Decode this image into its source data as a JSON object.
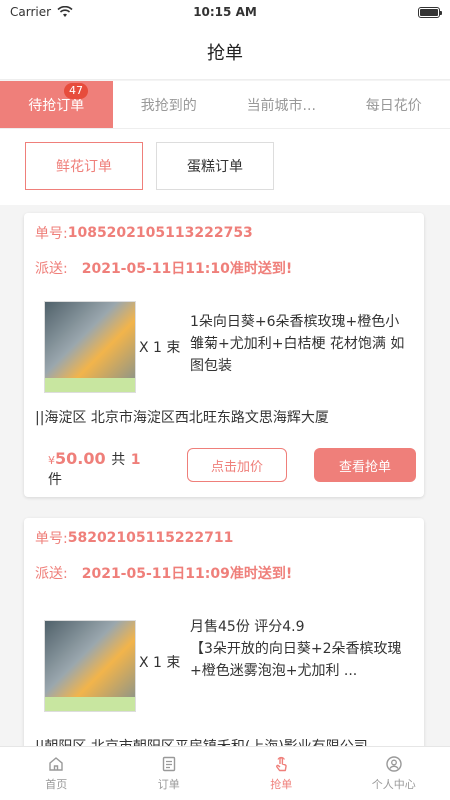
{
  "status": {
    "carrier": "Carrier",
    "time": "10:15 AM"
  },
  "header": {
    "title": "抢单"
  },
  "tabs": [
    {
      "label": "待抢订单",
      "badge": "47",
      "active": true
    },
    {
      "label": "我抢到的",
      "active": false
    },
    {
      "label": "当前城市...",
      "active": false
    },
    {
      "label": "每日花价",
      "active": false
    }
  ],
  "filters": [
    {
      "label": "鲜花订单",
      "active": true
    },
    {
      "label": "蛋糕订单",
      "active": false
    }
  ],
  "orders": [
    {
      "order_no_label": "单号:",
      "order_no": "1085202105113222753",
      "delivery_label": "派送:",
      "delivery_time": "2021-05-11日11:10准时送到!",
      "qty": "X 1 束",
      "desc": "1朵向日葵+6朵香槟玫瑰+橙色小雏菊+尤加利+白桔梗 花材饱满 如图包装",
      "address": "||海淀区  北京市海淀区西北旺东路文思海辉大厦",
      "currency": "¥",
      "price": "50.00",
      "count_prefix": "共",
      "count": "1",
      "count_suffix": "件",
      "add_price_label": "点击加价",
      "view_label": "查看抢单"
    },
    {
      "order_no_label": "单号:",
      "order_no": "58202105115222711",
      "delivery_label": "派送:",
      "delivery_time": "2021-05-11日11:09准时送到!",
      "qty": "X 1 束",
      "desc_line1": "月售45份  评分4.9",
      "desc": "【3朵开放的向日葵+2朵香槟玫瑰+橙色迷雾泡泡+尤加利      ...",
      "address": "||朝阳区  北京市朝阳区平房镇禾和(上海)影业有限公司"
    }
  ],
  "bottom_nav": [
    {
      "label": "首页",
      "icon": "home-icon",
      "active": false
    },
    {
      "label": "订单",
      "icon": "order-icon",
      "active": false
    },
    {
      "label": "抢单",
      "icon": "tap-icon",
      "active": true
    },
    {
      "label": "个人中心",
      "icon": "user-icon",
      "active": false
    }
  ],
  "colors": {
    "accent": "#ef7f7a",
    "badge": "#e74c3c"
  }
}
